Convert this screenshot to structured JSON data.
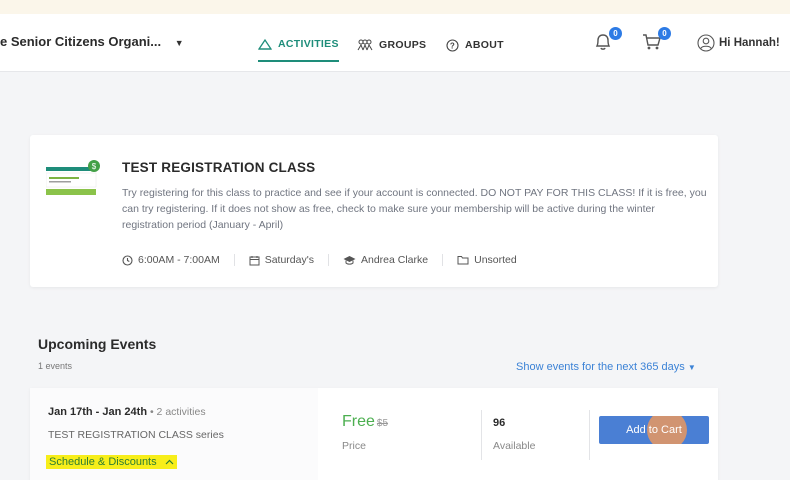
{
  "header": {
    "org_name": "e Senior Citizens Organi...",
    "tabs": [
      {
        "label": "ACTIVITIES",
        "icon": "activities-icon",
        "active": true
      },
      {
        "label": "GROUPS",
        "icon": "groups-icon",
        "active": false
      },
      {
        "label": "ABOUT",
        "icon": "help-circle-icon",
        "active": false
      }
    ],
    "notifications_count": "0",
    "cart_count": "0",
    "greeting": "Hi Hannah!"
  },
  "class": {
    "title": "TEST REGISTRATION CLASS",
    "description": "Try registering for this class to practice and see if your account is connected. DO NOT PAY FOR THIS CLASS! If it is free, you can try registering. If it does not show as free, check to make sure your membership will be active during the winter registration period (January - April)",
    "time": "6:00AM - 7:00AM",
    "day": "Saturday's",
    "instructor": "Andrea Clarke",
    "category": "Unsorted",
    "logo_badge": "$"
  },
  "upcoming": {
    "title": "Upcoming Events",
    "count_text": "1 events",
    "filter_text": "Show events for the next 365 days"
  },
  "event": {
    "dates": "Jan 17th - Jan 24th",
    "activities_text": " • 2 activities",
    "series": "TEST REGISTRATION CLASS series",
    "schedule_link": "Schedule & Discounts",
    "price": "Free",
    "original_price": "$5",
    "price_label": "Price",
    "available": "96",
    "available_label": "Available",
    "add_to_cart": "Add to Cart"
  },
  "colors": {
    "accent_teal": "#1e8d7a",
    "link_blue": "#3b82d6",
    "button_blue": "#4a7fd4",
    "free_green": "#4caf50",
    "highlight_yellow": "#f7ee1a"
  }
}
